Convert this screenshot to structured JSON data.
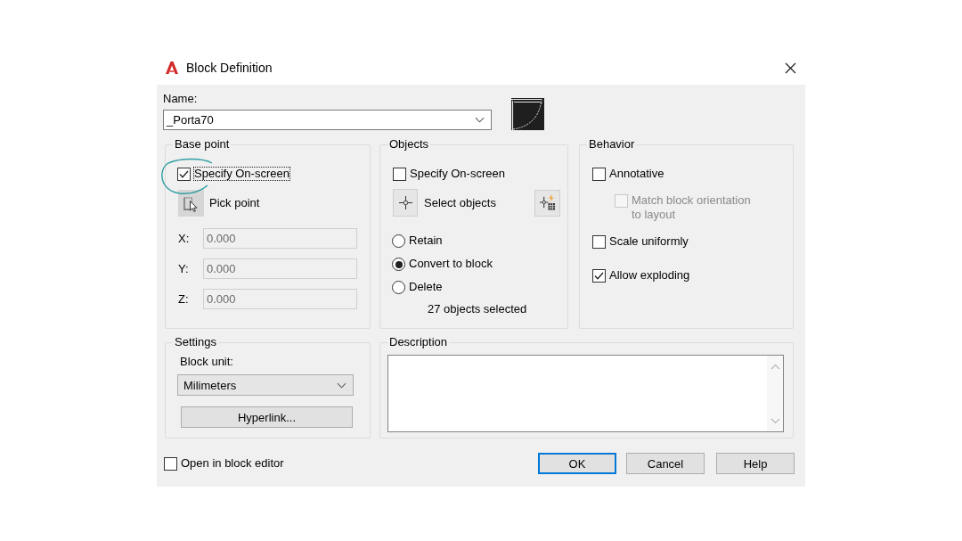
{
  "window": {
    "title": "Block Definition"
  },
  "name": {
    "label": "Name:",
    "value": "_Porta70"
  },
  "base_point": {
    "title": "Base point",
    "specify_on_screen": {
      "label": "Specify On-screen",
      "checked": true,
      "focused": true,
      "highlighted": true
    },
    "pick_point": {
      "label": "Pick point"
    },
    "coordinates": [
      {
        "label": "X:",
        "value": "0.000",
        "disabled": true
      },
      {
        "label": "Y:",
        "value": "0.000",
        "disabled": true
      },
      {
        "label": "Z:",
        "value": "0.000",
        "disabled": true
      }
    ]
  },
  "objects": {
    "title": "Objects",
    "specify_on_screen": {
      "label": "Specify On-screen",
      "checked": false,
      "focused": false
    },
    "select_objects": {
      "label": "Select objects"
    },
    "options": [
      {
        "label": "Retain",
        "selected": false
      },
      {
        "label": "Convert to block",
        "selected": true
      },
      {
        "label": "Delete",
        "selected": false
      }
    ],
    "status": "27 objects selected"
  },
  "behavior": {
    "title": "Behavior",
    "options": [
      {
        "label": "Annotative",
        "checked": false,
        "disabled": false,
        "sub_option": {
          "label": "Match block orientation to layout",
          "checked": false,
          "disabled": true
        }
      },
      {
        "label": "Scale uniformly",
        "checked": false,
        "disabled": false
      },
      {
        "label": "Allow exploding",
        "checked": true,
        "disabled": false
      }
    ]
  },
  "settings": {
    "title": "Settings",
    "block_unit": {
      "label": "Block unit:",
      "value": "Milimeters"
    },
    "hyperlink": "Hyperlink..."
  },
  "description": {
    "title": "Description"
  },
  "footer": {
    "open_in_block_editor": {
      "label": "Open in block editor",
      "checked": false
    },
    "buttons": [
      {
        "label": "OK",
        "default": true
      },
      {
        "label": "Cancel",
        "default": false
      },
      {
        "label": "Help",
        "default": false
      }
    ]
  }
}
